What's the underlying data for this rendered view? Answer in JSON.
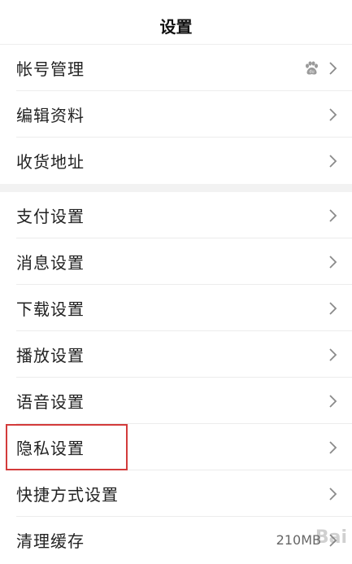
{
  "header": {
    "title": "设置"
  },
  "group1": [
    {
      "label": "帐号管理",
      "icon": "baidu-paw-icon"
    },
    {
      "label": "编辑资料"
    },
    {
      "label": "收货地址"
    }
  ],
  "group2": [
    {
      "label": "支付设置"
    },
    {
      "label": "消息设置"
    },
    {
      "label": "下载设置"
    },
    {
      "label": "播放设置"
    },
    {
      "label": "语音设置"
    },
    {
      "label": "隐私设置"
    },
    {
      "label": "快捷方式设置"
    },
    {
      "label": "清理缓存",
      "value": "210MB"
    }
  ],
  "colors": {
    "highlight": "#d33b3b",
    "divider": "#ececec",
    "group_gap": "#f2f2f2"
  },
  "watermark": "Bai"
}
